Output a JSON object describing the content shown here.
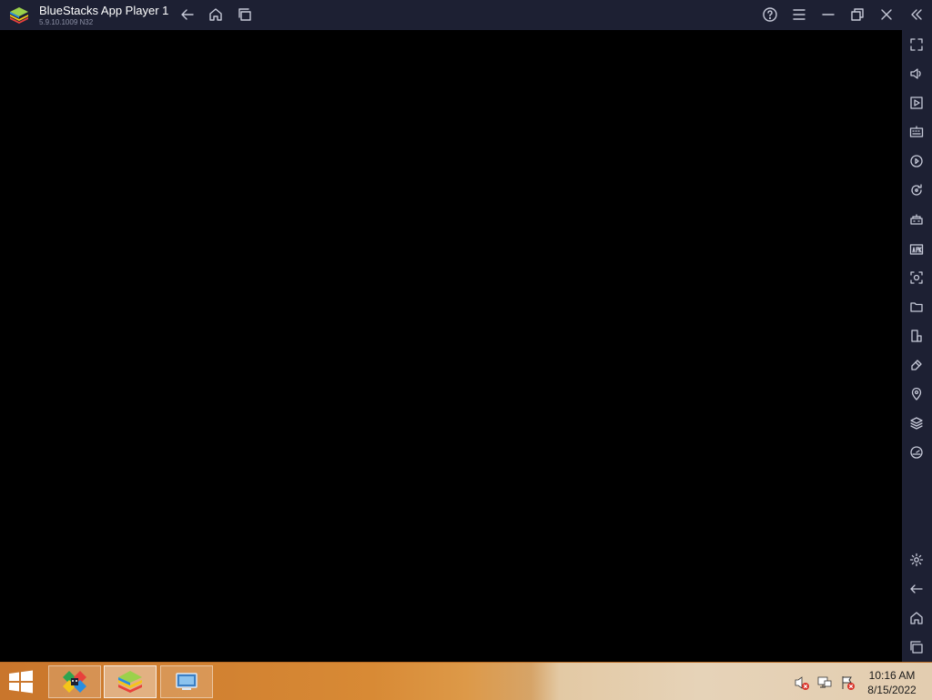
{
  "titlebar": {
    "title": "BlueStacks App Player 1",
    "version": "5.9.10.1009 N32",
    "buttons": [
      "back-icon",
      "home-icon",
      "recents-icon",
      "help-icon",
      "menu-icon",
      "minimize-icon",
      "restore-icon",
      "close-icon",
      "collapse-sidebar-icon"
    ]
  },
  "sidebar": {
    "top_tools": [
      "fullscreen-icon",
      "volume-icon",
      "media-manager-icon",
      "keyboard-icon",
      "record-icon",
      "rotate-icon",
      "macro-icon",
      "apk-install-icon",
      "screenshot-icon",
      "folder-icon",
      "multi-instance-icon",
      "eco-mode-icon",
      "location-icon",
      "layers-icon",
      "performance-icon"
    ],
    "bottom_tools": [
      "settings-icon",
      "back-icon",
      "home-icon",
      "recents-icon"
    ]
  },
  "taskbar": {
    "apps": [
      "multi-instance-manager-icon",
      "bluestacks-icon",
      "remote-desktop-icon"
    ],
    "tray": [
      "volume-muted-icon",
      "network-icon",
      "action-center-icon"
    ],
    "clock_time": "10:16 AM",
    "clock_date": "8/15/2022"
  },
  "colors": {
    "chrome": "#1d2033",
    "icon": "#c6c9d8",
    "viewport": "#000000",
    "taskbar_orange": "#d88a35"
  }
}
